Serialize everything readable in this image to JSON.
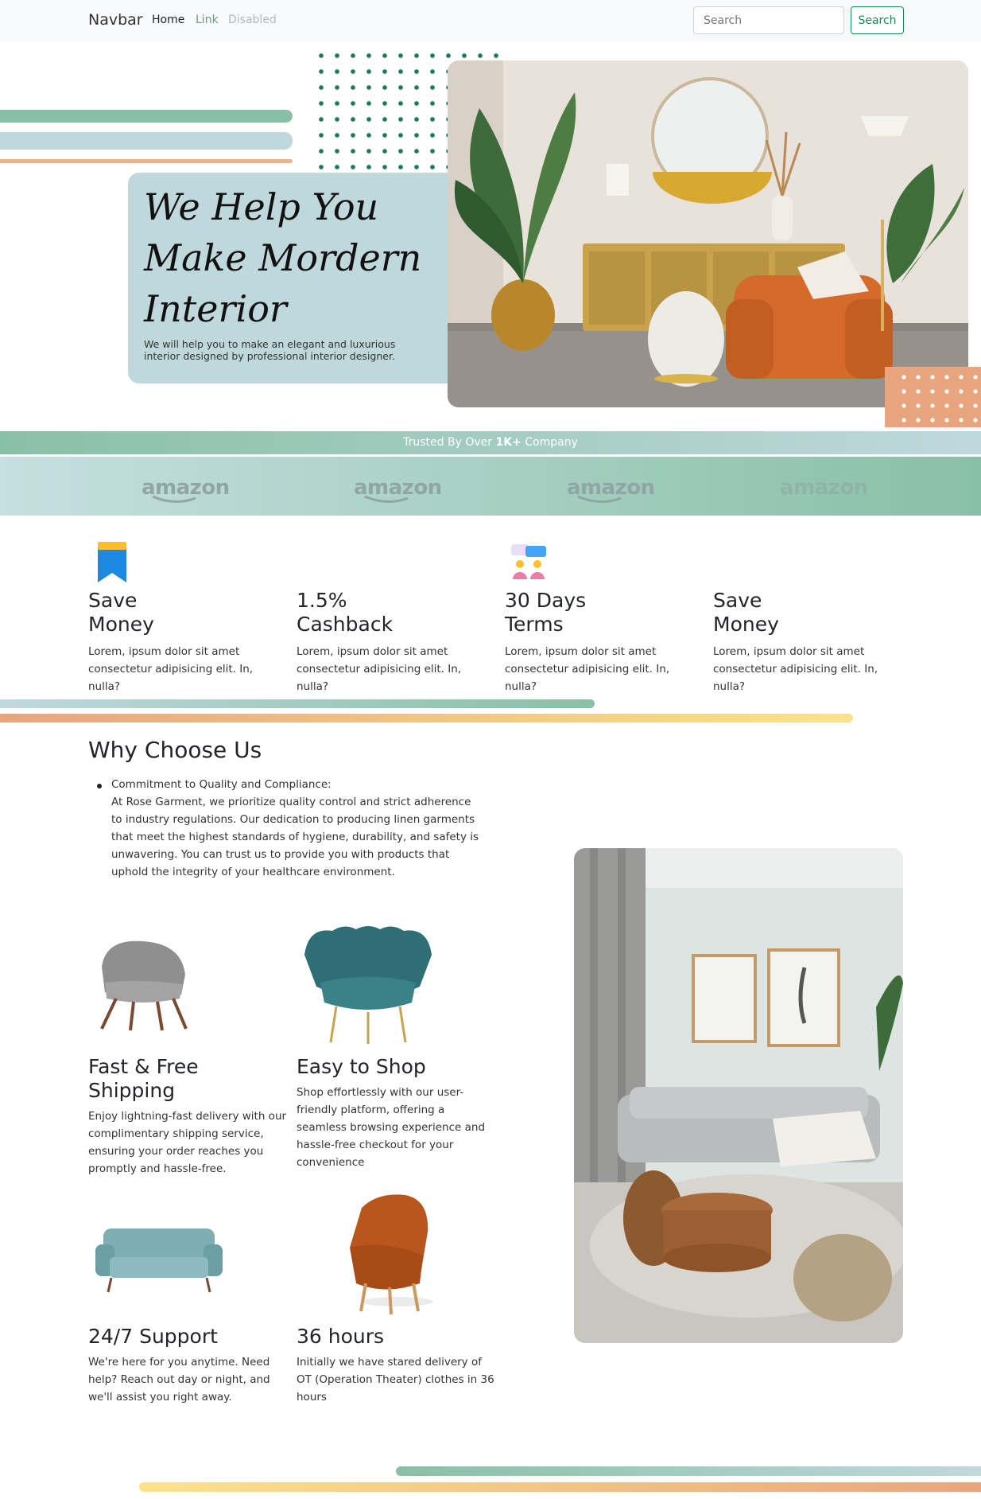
{
  "navbar": {
    "brand": "Navbar",
    "links": [
      "Home",
      "Link",
      "Disabled"
    ],
    "search_placeholder": "Search",
    "search_button": "Search"
  },
  "hero": {
    "title_line1": "We Help You",
    "title_line2": "Make Mordern",
    "title_line3": "Interior",
    "subtitle_line1": "We will help you to make an elegant and luxurious",
    "subtitle_line2": "interior designed by professional interior designer."
  },
  "trusted": {
    "prefix": "Trusted By Over ",
    "highlight": "1K+",
    "suffix": " Company",
    "logos": [
      "amazon",
      "amazon",
      "amazon",
      "amazon"
    ]
  },
  "features": [
    {
      "title_line1": "Save",
      "title_line2": "Money",
      "text": "Lorem, ipsum dolor sit amet consectetur adipisicing elit. In, nulla?",
      "icon": "bookmark-icon"
    },
    {
      "title_line1": "1.5%",
      "title_line2": "Cashback",
      "text": "Lorem, ipsum dolor sit amet consectetur adipisicing elit. In, nulla?",
      "icon": ""
    },
    {
      "title_line1": "30 Days",
      "title_line2": "Terms",
      "text": "Lorem, ipsum dolor sit amet consectetur adipisicing elit. In, nulla?",
      "icon": "chat-people-icon"
    },
    {
      "title_line1": "Save",
      "title_line2": "Money",
      "text": "Lorem, ipsum dolor sit amet consectetur adipisicing elit. In, nulla?",
      "icon": ""
    }
  ],
  "why": {
    "title": "Why Choose Us",
    "item_heading": "Commitment to Quality and Compliance:",
    "item_text": "At Rose Garment, we prioritize quality control and strict adherence to industry regulations. Our dedication to producing linen garments that meet the highest standards of hygiene, durability, and safety is unwavering. You can trust us to provide you with products that uphold the integrity of your healthcare environment."
  },
  "cards": [
    {
      "title": "Fast & Free Shipping",
      "text": "Enjoy lightning-fast delivery with our complimentary shipping service, ensuring your order reaches you promptly and hassle-free."
    },
    {
      "title": "Easy to Shop",
      "text": "Shop effortlessly with our user-friendly platform, offering a seamless browsing experience and hassle-free checkout for your convenience"
    },
    {
      "title": "24/7 Support",
      "text": "We're here for you anytime. Need help? Reach out day or night, and we'll assist you right away."
    },
    {
      "title": "36 hours",
      "text": "Initially we have stared delivery of OT (Operation Theater) clothes in 36 hours"
    }
  ],
  "colors": {
    "green": "#88c0a6",
    "light_blue": "#bfd8dc",
    "orange": "#e8a57e",
    "yellow": "#fbe38a",
    "dark_green": "#1f7a5a"
  }
}
